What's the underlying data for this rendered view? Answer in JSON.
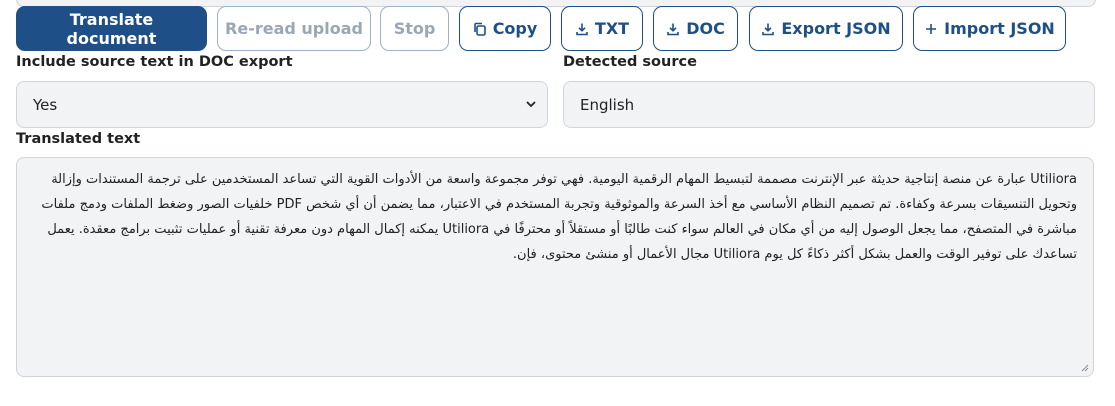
{
  "toolbar": {
    "translate_label": "Translate document",
    "reread_label": "Re-read upload",
    "stop_label": "Stop",
    "copy_label": "Copy",
    "txt_label": "TXT",
    "doc_label": "DOC",
    "export_json_label": "Export JSON",
    "import_json_label": "Import JSON",
    "icons": {
      "copy": "copy-icon",
      "txt": "download-icon",
      "doc": "download-icon",
      "export_json": "download-icon",
      "import_json": "plus-icon"
    }
  },
  "options": {
    "include_source_label": "Include source text in DOC export",
    "include_source_value": "Yes",
    "detected_source_label": "Detected source",
    "detected_source_value": "English"
  },
  "translation": {
    "label": "Translated text",
    "text": "Utiliora عبارة عن منصة إنتاجية حديثة عبر الإنترنت مصممة لتبسيط المهام الرقمية اليومية. فهي توفر مجموعة واسعة من الأدوات القوية التي تساعد المستخدمين على ترجمة المستندات وإزالة وتحويل التنسيقات بسرعة وكفاءة. تم تصميم النظام الأساسي مع أخذ السرعة والموثوقية وتجربة المستخدم في الاعتبار، مما يضمن أن أي شخص PDF خلفيات الصور وضغط الملفات ودمج ملفات مباشرة في المتصفح، مما يجعل الوصول إليه من أي مكان في العالم سواء كنت طالبًا أو مستقلاً أو محترفًا في Utiliora يمكنه إكمال المهام دون معرفة تقنية أو عمليات تثبيت برامج معقدة. يعمل تساعدك على توفير الوقت والعمل بشكل أكثر ذكاءً كل يوم Utiliora مجال الأعمال أو منشئ محتوى، فإن."
  },
  "colors": {
    "primary": "#1e4f86",
    "disabled_border": "#9db2c8",
    "field_bg": "#f1f3f5"
  }
}
